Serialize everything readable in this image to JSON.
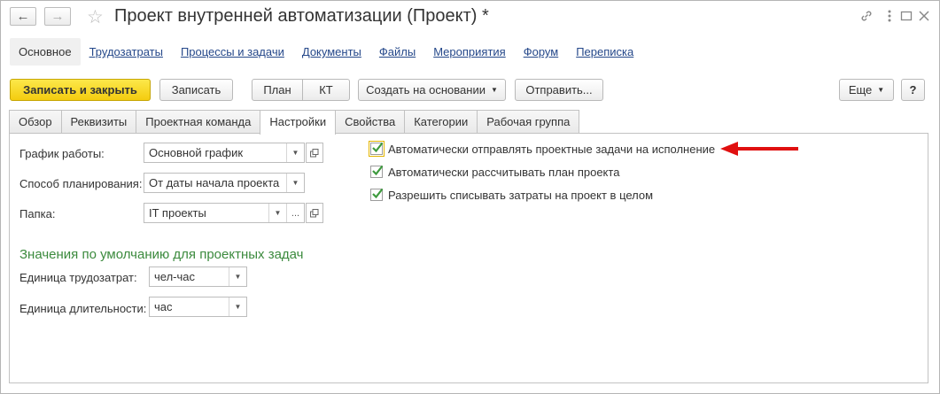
{
  "window": {
    "title": "Проект внутренней автоматизации (Проект) *"
  },
  "subnav": {
    "items": [
      "Основное",
      "Трудозатраты",
      "Процессы и задачи",
      "Документы",
      "Файлы",
      "Мероприятия",
      "Форум",
      "Переписка"
    ]
  },
  "toolbar": {
    "save_close": "Записать и закрыть",
    "save": "Записать",
    "plan": "План",
    "kt": "КТ",
    "create_based": "Создать на основании",
    "send": "Отправить...",
    "more": "Еще",
    "help": "?"
  },
  "tabs": [
    "Обзор",
    "Реквизиты",
    "Проектная команда",
    "Настройки",
    "Свойства",
    "Категории",
    "Рабочая группа"
  ],
  "settings": {
    "schedule_label": "График работы:",
    "schedule_value": "Основной график",
    "planning_label": "Способ планирования:",
    "planning_value": "От даты начала проекта",
    "folder_label": "Папка:",
    "folder_value": "IT проекты",
    "defaults_title": "Значения по умолчанию для проектных задач",
    "labor_unit_label": "Единица трудозатрат:",
    "labor_unit_value": "чел-час",
    "duration_unit_label": "Единица длительности:",
    "duration_unit_value": "час",
    "checkboxes": [
      {
        "label": "Автоматически отправлять проектные задачи на исполнение",
        "checked": true
      },
      {
        "label": "Автоматически рассчитывать план проекта",
        "checked": true
      },
      {
        "label": "Разрешить списывать затраты на проект в целом",
        "checked": true
      }
    ]
  },
  "colors": {
    "primary_button": "#f4cc0f",
    "link": "#25488a",
    "section_title": "#3b8a3d",
    "checkmark": "#3d9a3d",
    "arrow": "#e01010"
  },
  "icons": [
    "back-arrow-icon",
    "forward-arrow-icon",
    "star-icon",
    "link-icon",
    "more-vert-icon",
    "maximize-icon",
    "close-icon",
    "dropdown-icon",
    "open-icon",
    "red-arrow-icon"
  ]
}
